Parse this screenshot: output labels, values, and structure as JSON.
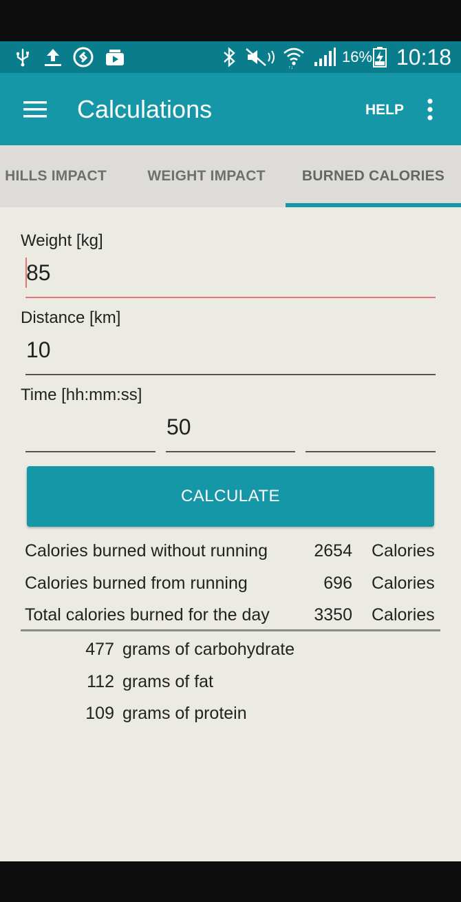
{
  "status_bar": {
    "battery_percent": "16%",
    "time": "10:18",
    "icons": [
      "usb-icon",
      "upload-icon",
      "shazam-icon",
      "media-icon",
      "bluetooth-icon",
      "mute-icon",
      "wifi-icon",
      "signal-icon",
      "battery-icon"
    ]
  },
  "toolbar": {
    "title": "Calculations",
    "help_label": "HELP"
  },
  "tabs": [
    {
      "label": "HILLS IMPACT"
    },
    {
      "label": "WEIGHT IMPACT"
    },
    {
      "label": "BURNED CALORIES",
      "selected": true
    }
  ],
  "colors": {
    "accent": "#1597a7",
    "status_bar": "#0a7d8c",
    "error_underline": "#e57373",
    "background": "#ebeae3"
  },
  "form": {
    "weight": {
      "label": "Weight [kg]",
      "value": "85"
    },
    "distance": {
      "label": "Distance [km]",
      "value": "10"
    },
    "time": {
      "label": "Time [hh:mm:ss]",
      "hours": "",
      "minutes": "50",
      "seconds": ""
    },
    "calculate_label": "CALCULATE"
  },
  "results": {
    "rows": [
      {
        "label": "Calories burned without running",
        "value": "2654",
        "unit": "Calories"
      },
      {
        "label": "Calories burned from running",
        "value": "696",
        "unit": "Calories"
      },
      {
        "label": "Total calories burned for the day",
        "value": "3350",
        "unit": "Calories"
      }
    ],
    "macros": [
      {
        "value": "477",
        "label": "grams of carbohydrate"
      },
      {
        "value": "112",
        "label": "grams of fat"
      },
      {
        "value": "109",
        "label": "grams of protein"
      }
    ]
  }
}
